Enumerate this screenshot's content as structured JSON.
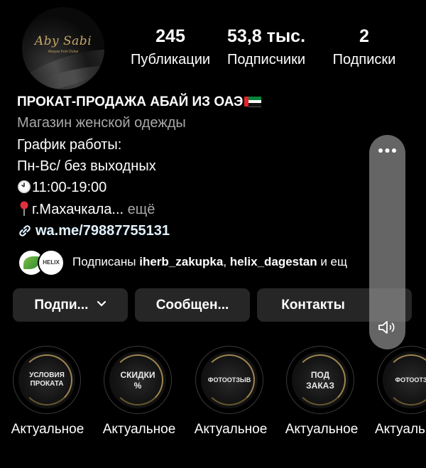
{
  "profile": {
    "avatar": {
      "logo_text": "Aby Sabi",
      "logo_sub": "Abayas from Dubai"
    },
    "stats": [
      {
        "value": "245",
        "label": "Публикации"
      },
      {
        "value": "53,8 тыс.",
        "label": "Подписчики"
      },
      {
        "value": "2",
        "label": "Подписки"
      }
    ],
    "name": "ПРОКАТ-ПРОДАЖА АБАЙ ИЗ ОАЭ",
    "category": "Магазин женской одежды",
    "bio_lines": [
      "График работы:",
      "Пн-Вс/ без выходных",
      "11:00-19:00",
      "г.Махачкала..."
    ],
    "bio_more": " ещё",
    "link": "wa.me/79887755131",
    "followed_by": {
      "prefix": "Подписаны ",
      "user1": "iherb_zakupka",
      "sep": ", ",
      "user2": "helix_dagestan",
      "suffix": " и ещ",
      "avatar2_text": "HELIX"
    }
  },
  "buttons": {
    "follow": "Подпи...",
    "message": "Сообщен...",
    "contacts": "Контакты"
  },
  "highlights": [
    {
      "cover_text": "УСЛОВИЯ ПРОКАТА",
      "label": "Актуальное"
    },
    {
      "cover_text": "СКИДКИ %",
      "label": "Актуальное"
    },
    {
      "cover_text": "ФОТООТЗЫВ",
      "label": "Актуальное"
    },
    {
      "cover_text": "ПОД ЗАКАЗ",
      "label": "Актуальное"
    },
    {
      "cover_text": "ФОТООТЗ",
      "label": "Актуальн"
    }
  ],
  "icons": {
    "clock": "clock-icon",
    "pin": "map-pin-icon",
    "link": "link-icon",
    "flag": "uae-flag-icon",
    "chevron": "chevron-down-icon",
    "more": "more-dots-icon",
    "speaker": "speaker-icon"
  },
  "colors": {
    "background": "#000000",
    "button": "#262626",
    "secondary_text": "#a8a8a8",
    "accent_gold": "#b89a5c"
  }
}
